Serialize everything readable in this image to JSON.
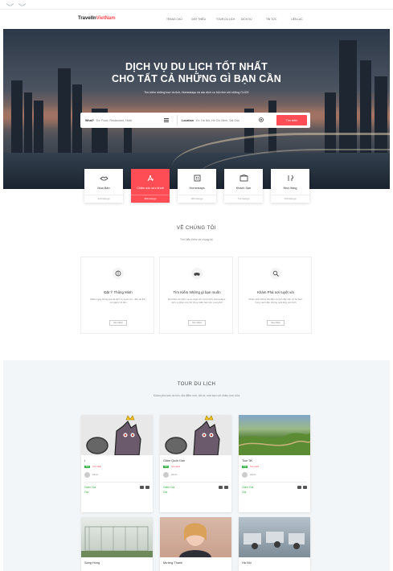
{
  "topbar": {
    "left": [
      "",
      ""
    ],
    "right": [
      "",
      "",
      ""
    ]
  },
  "header": {
    "logo_main": "TravelIn",
    "logo_accent": "VietNam",
    "nav": [
      "TRANG CHỦ",
      "GIỚI THIỆU",
      "TOUR DU LỊCH",
      "DỊCH VỤ",
      "TIN TỨC",
      "LIÊN LẠC"
    ]
  },
  "hero": {
    "title_line1": "DỊCH VỤ DU LỊCH TỐT NHẤT",
    "title_line2": "CHO TẤT CẢ NHỮNG GÌ BẠN CẦN",
    "subtitle": "Tìm kiếm những tour du lịch, Homestays và các dịch vụ hội nhờ với những CLICK",
    "search": {
      "what_label": "What?",
      "what_value": "Ex: Food, Restaurant, Hotel",
      "location_label": "Location",
      "location_value": "Ex: Hà Nội, Hồ Chí Minh, Sài Gòn",
      "button": "Tìm kiếm"
    }
  },
  "categories": [
    {
      "name": "Mua Bán",
      "listings": "220 listings"
    },
    {
      "name": "Chăm sóc sức khoẻ",
      "listings": "280 listings"
    },
    {
      "name": "Homestays",
      "listings": "180 listings"
    },
    {
      "name": "Khách Sạn",
      "listings": "712 listings"
    },
    {
      "name": "Nhà Hàng",
      "listings": "700 listings"
    }
  ],
  "about": {
    "title": "VỀ CHÚNG TÔI",
    "subtitle": "Tìm hiểu thêm về chúng tôi",
    "features": [
      {
        "title": "Đặt Ý Thông Minh",
        "desc": "Nhiều ngày thông qua đa dịch vụ tuyệt vời... đến du lịch, nơi giải trí đi đến",
        "button": "Xem thêm"
      },
      {
        "title": "Tìm Kiếm Những gì bạn muốn",
        "desc": "Đã nhiều tìm kiếm và sự tuyệt vời mà du lịch, Homestays, dịch vụ khác mà chủ Vùng miền bạn nên mong đợi",
        "button": "Xem thêm"
      },
      {
        "title": "Khám Phá nơi tuyệt vời",
        "desc": "Khám phá những địa điểm du lịch đặc sắc, từ bờ biển trong xanh đến những ngôi làng yên bình",
        "button": "Xem thêm"
      }
    ]
  },
  "tours": {
    "title": "TOUR DU LỊCH",
    "subtitle": "Khám phá bán du lịch, địa điểm mới, tất cả, mời bạn với nhiều hơn nữa",
    "items": [
      {
        "name": "I",
        "badge": "5.0",
        "reviews": "Not rated",
        "author": "Admin",
        "price": "Giảm Giá",
        "price2": "Giá"
      },
      {
        "name": "Giảm Quốc Dan",
        "badge": "5.0",
        "reviews": "Not rated",
        "author": "Admin",
        "price": "Giảm Giá",
        "price2": "Giá"
      },
      {
        "name": "Tour 3K",
        "badge": "5.0",
        "reviews": "Not rated",
        "author": "Admin",
        "price": "Giảm Giá",
        "price2": "Giá"
      },
      {
        "name": "Sang Hồng"
      },
      {
        "name": "Mường Thanh"
      },
      {
        "name": "Hà Nội"
      }
    ]
  }
}
